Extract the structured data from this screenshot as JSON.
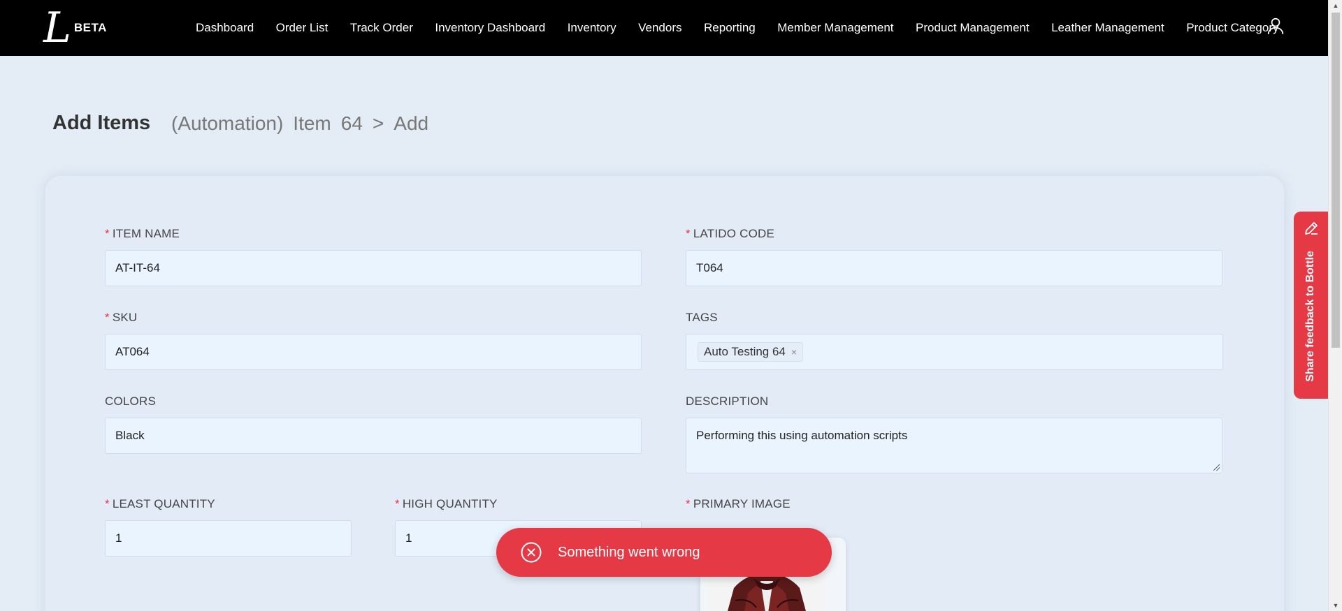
{
  "app": {
    "logo_mark": "L",
    "logo_badge": "BETA"
  },
  "nav": {
    "items": [
      {
        "label": "Dashboard"
      },
      {
        "label": "Order List"
      },
      {
        "label": "Track Order"
      },
      {
        "label": "Inventory Dashboard"
      },
      {
        "label": "Inventory"
      },
      {
        "label": "Vendors"
      },
      {
        "label": "Reporting"
      },
      {
        "label": "Member Management"
      },
      {
        "label": "Product Management"
      },
      {
        "label": "Leather Management"
      },
      {
        "label": "Product Category"
      }
    ],
    "user_icon": "user-icon"
  },
  "header": {
    "title": "Add Items",
    "breadcrumb": [
      "(Automation)",
      "Item",
      "64",
      ">",
      "Add"
    ]
  },
  "form": {
    "item_name": {
      "label": "ITEM NAME",
      "value": "AT-IT-64",
      "required": true
    },
    "latido_code": {
      "label": "LATIDO CODE",
      "value": "T064",
      "required": true
    },
    "sku": {
      "label": "SKU",
      "value": "AT064",
      "required": true
    },
    "tags": {
      "label": "TAGS",
      "values": [
        "Auto Testing 64"
      ],
      "remove_glyph": "×"
    },
    "colors": {
      "label": "COLORS",
      "value": "Black"
    },
    "description": {
      "label": "DESCRIPTION",
      "value": "Performing this using automation scripts"
    },
    "least_quantity": {
      "label": "LEAST QUANTITY",
      "value": "1",
      "required": true
    },
    "high_quantity": {
      "label": "HIGH QUANTITY",
      "value": "1",
      "required": true
    },
    "primary_image": {
      "label": "PRIMARY IMAGE",
      "required": true
    },
    "required_marker": "*"
  },
  "toast": {
    "message": "Something went wrong",
    "icon": "close-circle-icon",
    "color": "#e53945"
  },
  "feedback": {
    "label": "Share feedback to Bottle",
    "icon": "pencil-icon",
    "color": "#e53945"
  },
  "colors": {
    "topbar": "#000000",
    "page_bg": "#e4edf6",
    "input_bg": "#eaf4ff",
    "accent_red": "#e53945"
  }
}
